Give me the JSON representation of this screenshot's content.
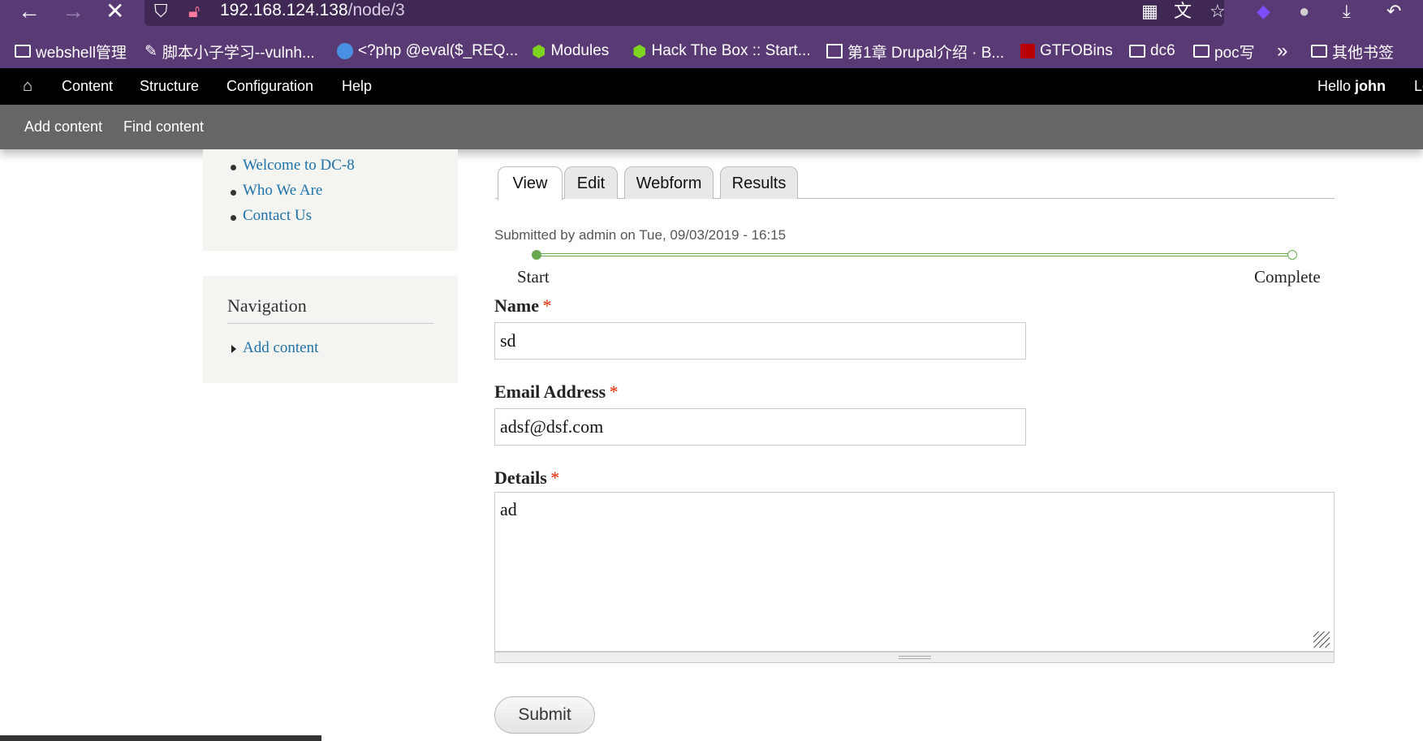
{
  "browser": {
    "url_host": "192.168.124.138",
    "url_path": "/node/3",
    "bookmarks": [
      {
        "label": "webshell管理",
        "icon": "folder-icon"
      },
      {
        "label": "脚本小子学习--vulnh...",
        "icon": "script-icon"
      },
      {
        "label": "<?php @eval($_REQ...",
        "icon": "search-icon"
      },
      {
        "label": "Modules",
        "icon": "cube-icon"
      },
      {
        "label": "Hack The Box :: Start...",
        "icon": "cube-icon"
      },
      {
        "label": "第1章 Drupal介绍 · B...",
        "icon": "book-icon"
      },
      {
        "label": "GTFOBins",
        "icon": "grid-icon"
      },
      {
        "label": "dc6",
        "icon": "folder-icon"
      },
      {
        "label": "poc写",
        "icon": "folder-icon"
      },
      {
        "label": "»",
        "icon": "overflow-icon"
      },
      {
        "label": "其他书签",
        "icon": "folder-icon"
      }
    ]
  },
  "toolbar": {
    "items": [
      "Content",
      "Structure",
      "Configuration",
      "Help"
    ],
    "greeting": "Hello ",
    "user": "john",
    "logout_partial": "Lo",
    "tray": [
      "Add content",
      "Find content"
    ]
  },
  "sidebar": {
    "menu_links": [
      "Welcome to DC-8",
      "Who We Are",
      "Contact Us"
    ],
    "nav_title": "Navigation",
    "nav_link": "Add content"
  },
  "tabs": [
    "View",
    "Edit",
    "Webform",
    "Results"
  ],
  "submitted": "Submitted by admin on Tue, 09/03/2019 - 16:15",
  "progress": {
    "start": "Start",
    "complete": "Complete",
    "fraction": 0
  },
  "form": {
    "name_label": "Name",
    "name_value": "sd",
    "email_label": "Email Address",
    "email_value": "adsf@dsf.com",
    "details_label": "Details",
    "details_value": "ad",
    "required_mark": "*",
    "submit_label": "Submit"
  },
  "colors": {
    "toolbar": "#000000",
    "tray": "#666666",
    "link": "#1d73a8",
    "progress": "#6aa84f",
    "required": "#e62600",
    "browser": "#5a3a74"
  }
}
